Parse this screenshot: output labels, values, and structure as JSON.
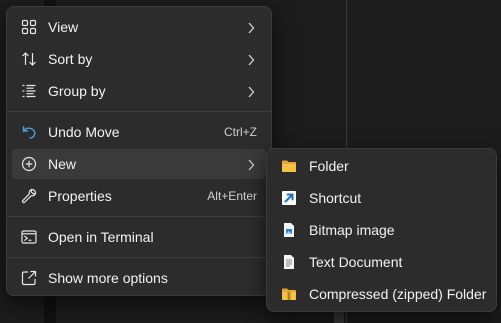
{
  "context_menu": {
    "items": [
      {
        "label": "View",
        "icon": "grid-icon"
      },
      {
        "label": "Sort by",
        "icon": "sort-icon"
      },
      {
        "label": "Group by",
        "icon": "list-icon"
      },
      {
        "label": "Undo Move",
        "shortcut": "Ctrl+Z",
        "icon": "undo-icon"
      },
      {
        "label": "New",
        "icon": "new-plus-icon"
      },
      {
        "label": "Properties",
        "shortcut": "Alt+Enter",
        "icon": "wrench-icon"
      },
      {
        "label": "Open in Terminal",
        "icon": "terminal-icon"
      },
      {
        "label": "Show more options",
        "icon": "share-icon"
      }
    ]
  },
  "new_submenu": {
    "items": [
      {
        "label": "Folder",
        "icon": "folder-icon"
      },
      {
        "label": "Shortcut",
        "icon": "shortcut-icon"
      },
      {
        "label": "Bitmap image",
        "icon": "bitmap-icon"
      },
      {
        "label": "Text Document",
        "icon": "text-document-icon"
      },
      {
        "label": "Compressed (zipped) Folder",
        "icon": "zip-folder-icon"
      }
    ]
  },
  "colors": {
    "menu_bg": "#2c2c2c",
    "highlight": "#3a3a3a",
    "accent_blue": "#4ca0e0",
    "folder_yellow": "#f5c244"
  }
}
